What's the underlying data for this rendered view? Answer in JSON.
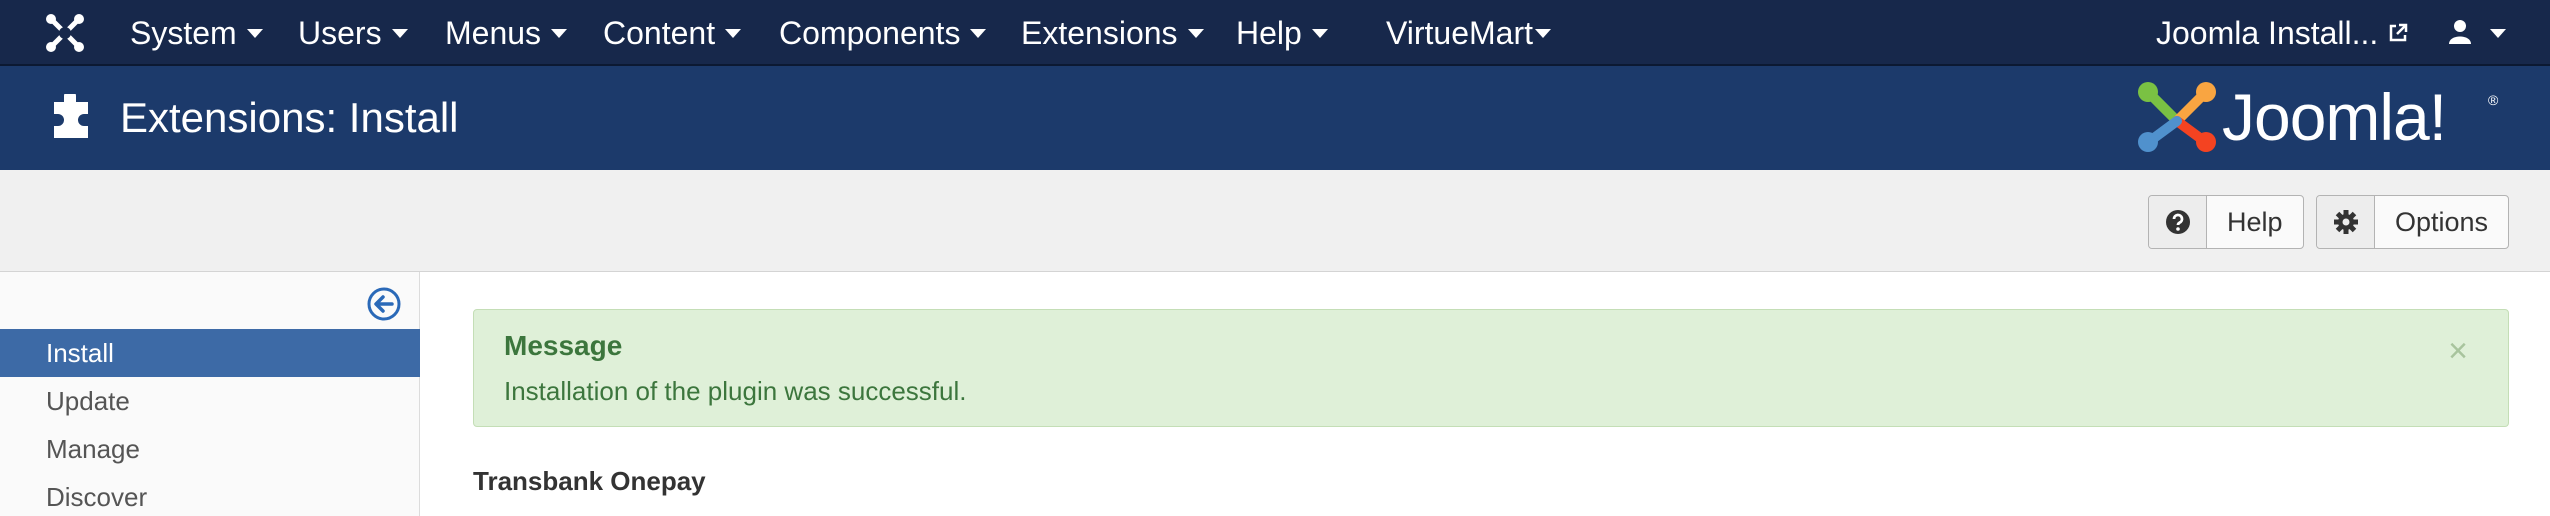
{
  "topnav": {
    "menus": [
      "System",
      "Users",
      "Menus",
      "Content",
      "Components",
      "Extensions",
      "Help",
      "VirtueMart"
    ],
    "site_link": "Joomla Install...",
    "icons": {
      "brand": "joomla-icon",
      "user": "user-icon",
      "external": "external-link-icon"
    }
  },
  "header": {
    "title": "Extensions: Install",
    "logo_text": "Joomla!",
    "logo_reg": "®"
  },
  "toolbar": {
    "help_label": "Help",
    "options_label": "Options"
  },
  "sidebar": {
    "items": [
      {
        "label": "Install",
        "active": true
      },
      {
        "label": "Update",
        "active": false
      },
      {
        "label": "Manage",
        "active": false
      },
      {
        "label": "Discover",
        "active": false
      }
    ]
  },
  "message": {
    "heading": "Message",
    "body": "Installation of the plugin was successful.",
    "close": "×"
  },
  "extension_name": "Transbank Onepay",
  "colors": {
    "navbar": "#17284b",
    "header": "#1c3a6b",
    "active": "#3d6aa6",
    "alert_bg": "#dff0d8",
    "alert_text": "#3c763d"
  }
}
